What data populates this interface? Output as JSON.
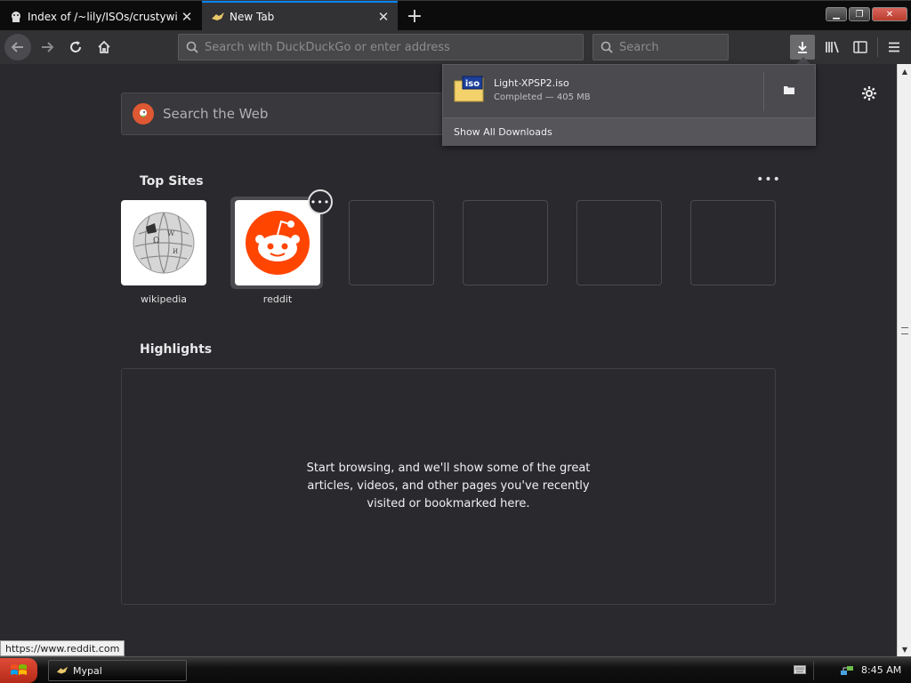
{
  "tabs": [
    {
      "title": "Index of /~lily/ISOs/crustywindow",
      "icon": "ghost-icon"
    },
    {
      "title": "New Tab",
      "icon": "mypal-icon"
    }
  ],
  "window_controls": {
    "minimize": "▁",
    "restore": "❐",
    "close": "✕"
  },
  "navbar": {
    "urlbar_placeholder": "Search with DuckDuckGo or enter address",
    "searchbar_placeholder": "Search"
  },
  "newtab": {
    "web_search_placeholder": "Search the Web",
    "top_sites_title": "Top Sites",
    "top_sites": [
      {
        "label": "wikipedia",
        "icon": "wikipedia-icon"
      },
      {
        "label": "reddit",
        "icon": "reddit-icon"
      },
      {
        "label": ""
      },
      {
        "label": ""
      },
      {
        "label": ""
      },
      {
        "label": ""
      }
    ],
    "highlights_title": "Highlights",
    "highlights_message": "Start browsing, and we'll show some of the great articles, videos, and other pages you've recently visited or bookmarked here."
  },
  "downloads_panel": {
    "file_name": "Light-XPSP2.iso",
    "file_icon_text": "iso",
    "status": "Completed — 405 MB",
    "show_all_label": "Show All Downloads"
  },
  "status_link": "https://www.reddit.com",
  "taskbar": {
    "task_label": "Mypal",
    "clock": "8:45 AM"
  },
  "colors": {
    "accent": "#0a84ff",
    "page_bg": "#2a2a2e",
    "reddit": "#ff4500",
    "ddg": "#de5833"
  }
}
